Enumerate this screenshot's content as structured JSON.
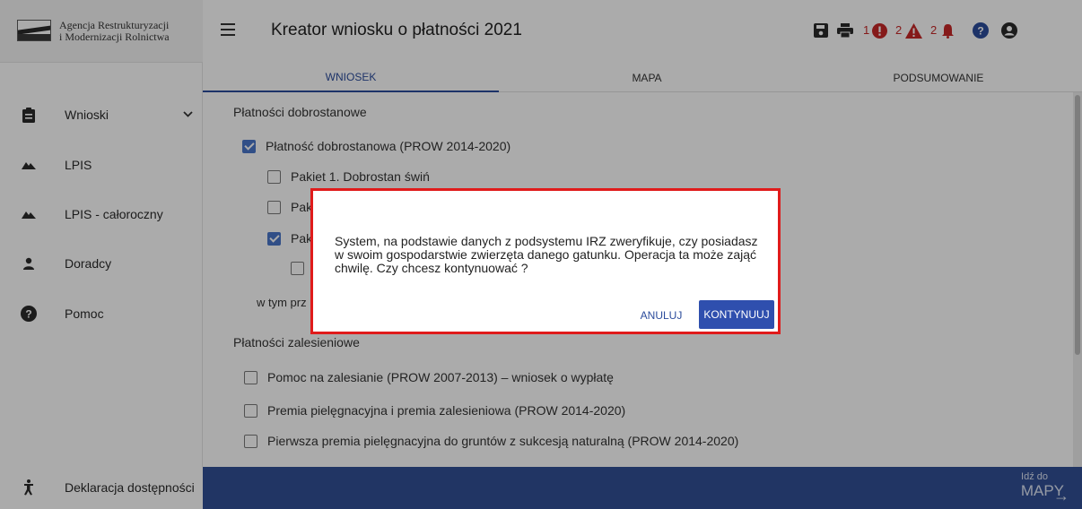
{
  "logo": {
    "line1": "Agencja Restrukturyzacji",
    "line2": "i Modernizacji Rolnictwa",
    "mark_text": "ARiMR"
  },
  "header": {
    "title": "Kreator wniosku o płatności 2021",
    "errors_count": "1",
    "warnings_count": "2",
    "notifications_count": "2"
  },
  "sidebar": {
    "items": [
      {
        "label": "Wnioski",
        "icon": "clipboard-icon"
      },
      {
        "label": "LPIS",
        "icon": "mountain-icon"
      },
      {
        "label": "LPIS - całoroczny",
        "icon": "mountain-icon"
      },
      {
        "label": "Doradcy",
        "icon": "person-icon"
      },
      {
        "label": "Pomoc",
        "icon": "help-icon"
      }
    ],
    "footer": {
      "label": "Deklaracja dostępności",
      "icon": "accessibility-icon"
    }
  },
  "tabs": [
    {
      "label": "WNIOSEK",
      "active": true
    },
    {
      "label": "MAPA",
      "active": false
    },
    {
      "label": "PODSUMOWANIE",
      "active": false
    }
  ],
  "content": {
    "section1_title": "Płatności dobrostanowe",
    "item_main": "Płatność dobrostanowa (PROW 2014-2020)",
    "item_pakiet1": "Pakiet 1. Dobrostan świń",
    "item_pak2": "Pak",
    "item_pak3": "Pak",
    "w_tym": "w tym prz",
    "section2_title": "Płatności zalesieniowe",
    "zal_items": [
      "Pomoc na zalesianie (PROW 2007-2013) – wniosek o wypłatę",
      "Premia pielęgnacyjna i premia zalesieniowa (PROW 2014-2020)",
      "Pierwsza premia pielęgnacyjna do gruntów z sukcesją naturalną (PROW 2014-2020)"
    ]
  },
  "bottom_bar": {
    "small": "Idź do",
    "big": "MAPY"
  },
  "dialog": {
    "message": "System, na podstawie danych z podsystemu IRZ zweryfikuje, czy posiadasz w swoim gospodarstwie zwierzęta danego gatunku. Operacja ta może zająć chwilę. Czy chcesz kontynuować ?",
    "cancel_label": "ANULUJ",
    "continue_label": "KONTYNUUJ"
  },
  "colors": {
    "accent": "#2c4c9c",
    "bottom_bar": "#324f95",
    "alert": "#c62828",
    "highlight": "#e01b1b"
  }
}
